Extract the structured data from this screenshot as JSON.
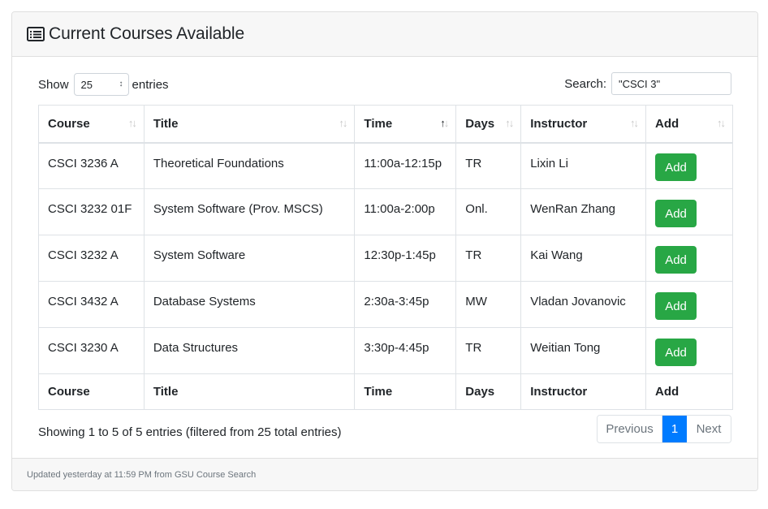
{
  "header": {
    "title": "Current Courses Available",
    "icon": "list-alt-icon"
  },
  "controls": {
    "show_label": "Show",
    "entries_value": "25",
    "entries_label": "entries",
    "search_label": "Search:",
    "search_value": "\"CSCI 3\""
  },
  "table": {
    "columns": [
      "Course",
      "Title",
      "Time",
      "Days",
      "Instructor",
      "Add"
    ],
    "sorted_column": "Time",
    "rows": [
      {
        "course": "CSCI 3236 A",
        "title": "Theoretical Foundations",
        "time": "11:00a-12:15p",
        "days": "TR",
        "instructor": "Lixin Li",
        "add": "Add"
      },
      {
        "course": "CSCI 3232 01F",
        "title": "System Software (Prov. MSCS)",
        "time": "11:00a-2:00p",
        "days": "Onl.",
        "instructor": "WenRan Zhang",
        "add": "Add"
      },
      {
        "course": "CSCI 3232 A",
        "title": "System Software",
        "time": "12:30p-1:45p",
        "days": "TR",
        "instructor": "Kai Wang",
        "add": "Add"
      },
      {
        "course": "CSCI 3432 A",
        "title": "Database Systems",
        "time": "2:30a-3:45p",
        "days": "MW",
        "instructor": "Vladan Jovanovic",
        "add": "Add"
      },
      {
        "course": "CSCI 3230 A",
        "title": "Data Structures",
        "time": "3:30p-4:45p",
        "days": "TR",
        "instructor": "Weitian Tong",
        "add": "Add"
      }
    ],
    "footer_columns": [
      "Course",
      "Title",
      "Time",
      "Days",
      "Instructor",
      "Add"
    ]
  },
  "info": "Showing 1 to 5 of 5 entries (filtered from 25 total entries)",
  "pagination": {
    "previous": "Previous",
    "current": "1",
    "next": "Next"
  },
  "footer": {
    "text": "Updated yesterday at 11:59 PM from GSU Course Search"
  },
  "colors": {
    "add_button": "#28a745",
    "current_page": "#007bff"
  }
}
